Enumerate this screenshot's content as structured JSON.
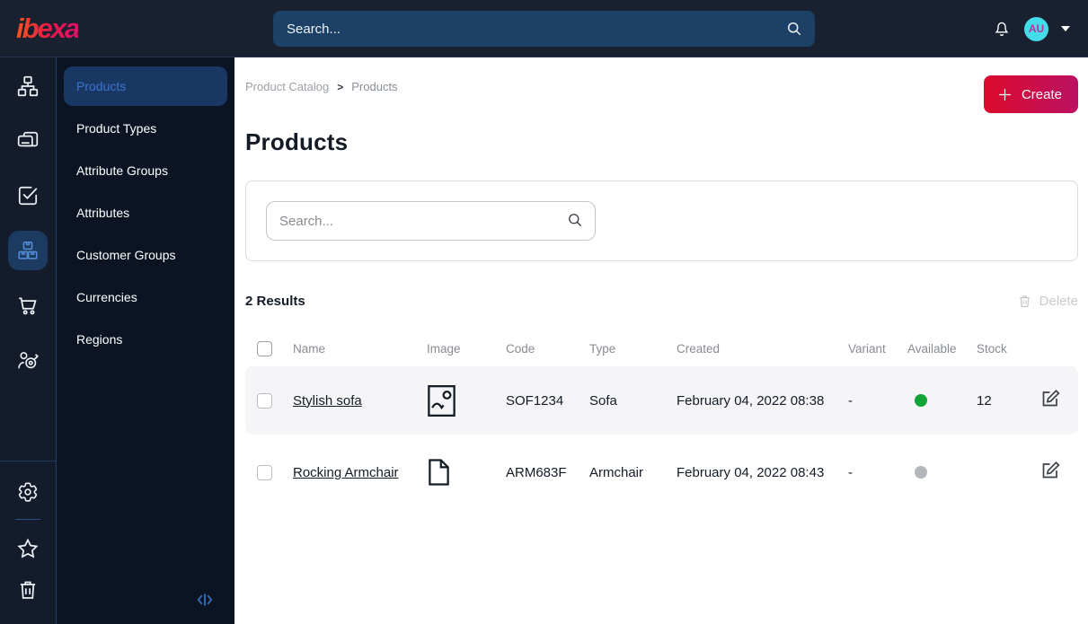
{
  "topbar": {
    "logo_text": "ibexa",
    "search_placeholder": "Search...",
    "user_initials": "AU"
  },
  "nav_rail": {
    "icons": [
      "content-tree",
      "pages",
      "tasks",
      "product-catalog",
      "commerce",
      "customers"
    ],
    "active_icon": "product-catalog",
    "footer_icons": [
      "settings",
      "bookmarks",
      "trash"
    ]
  },
  "sidebar": {
    "items": [
      {
        "label": "Products",
        "active": true
      },
      {
        "label": "Product Types",
        "active": false
      },
      {
        "label": "Attribute Groups",
        "active": false
      },
      {
        "label": "Attributes",
        "active": false
      },
      {
        "label": "Customer Groups",
        "active": false
      },
      {
        "label": "Currencies",
        "active": false
      },
      {
        "label": "Regions",
        "active": false
      }
    ]
  },
  "page": {
    "breadcrumb": [
      "Product Catalog",
      "Products"
    ],
    "breadcrumb_separator": ">",
    "create_button": "Create",
    "title": "Products",
    "filter_search_placeholder": "Search...",
    "results_label": "2 Results",
    "delete_button": "Delete",
    "table": {
      "headers": [
        "Name",
        "Image",
        "Code",
        "Type",
        "Created",
        "Variant",
        "Available",
        "Stock"
      ],
      "rows": [
        {
          "name": "Stylish sofa",
          "image_icon": "image-icon",
          "code": "SOF1234",
          "type": "Sofa",
          "created": "February 04, 2022 08:38",
          "variant": "-",
          "available": "available",
          "stock": "12"
        },
        {
          "name": "Rocking Armchair",
          "image_icon": "file-icon",
          "code": "ARM683F",
          "type": "Armchair",
          "created": "February 04, 2022 08:43",
          "variant": "-",
          "available": "unavailable",
          "stock": ""
        }
      ]
    }
  },
  "colors": {
    "topbar_bg": "#19202f",
    "rail_bg": "#141b2b",
    "sidebar_bg": "#0c1424",
    "active_pill_bg": "#183863",
    "active_text": "#3d74c9",
    "accent_gradient": [
      "#dc0b2c",
      "#bb1162"
    ],
    "available_green": "#13a438",
    "unavailable_gray": "#b3b7bb",
    "avatar_bg": "#45dce9",
    "avatar_text": "#b5339c"
  }
}
